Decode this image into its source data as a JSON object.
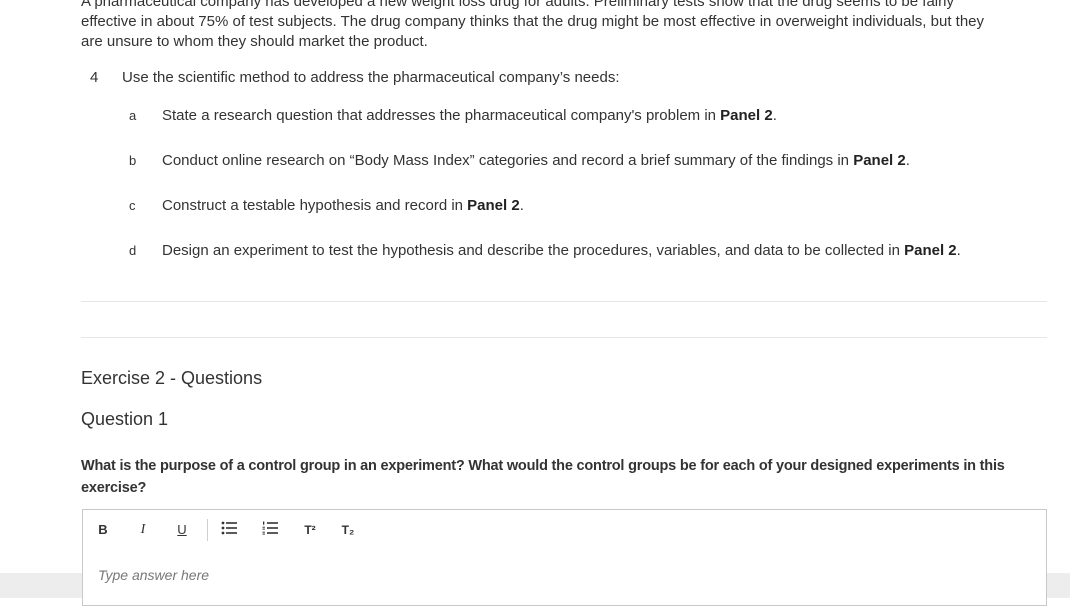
{
  "intro": {
    "line0": "A pharmaceutical company has developed a new weight loss drug for adults. Preliminary tests show that the drug seems to be fairly",
    "line1": "effective in about 75% of test subjects. The drug company thinks that the drug might be most effective in overweight individuals, but they",
    "line2": "are unsure to whom they should market the product."
  },
  "step": {
    "number": "4",
    "text": "Use the scientific method to address the pharmaceutical company’s needs:"
  },
  "subitems": [
    {
      "letter": "a",
      "text": "State a research question that addresses the pharmaceutical company's problem in ",
      "panel": "Panel 2",
      "end": "."
    },
    {
      "letter": "b",
      "text": "Conduct online research on “Body Mass Index” categories and record a brief summary of the findings in ",
      "panel": "Panel 2",
      "end": "."
    },
    {
      "letter": "c",
      "text": "Construct a testable hypothesis and record in ",
      "panel": "Panel 2",
      "end": "."
    },
    {
      "letter": "d",
      "text": "Design an experiment to test the hypothesis and describe the procedures, variables, and data to be collected in ",
      "panel": "Panel 2",
      "end": "."
    }
  ],
  "exercise_title": "Exercise 2 - Questions",
  "question_title": "Question 1",
  "question_prompt": "What is the purpose of a control group in an experiment? What would the control groups be for each of your designed experiments in this exercise?",
  "editor": {
    "toolbar": {
      "bold": "B",
      "italic": "I",
      "underline": "U",
      "superscript": "T²",
      "subscript": "T₂"
    },
    "placeholder": "Type answer here"
  }
}
